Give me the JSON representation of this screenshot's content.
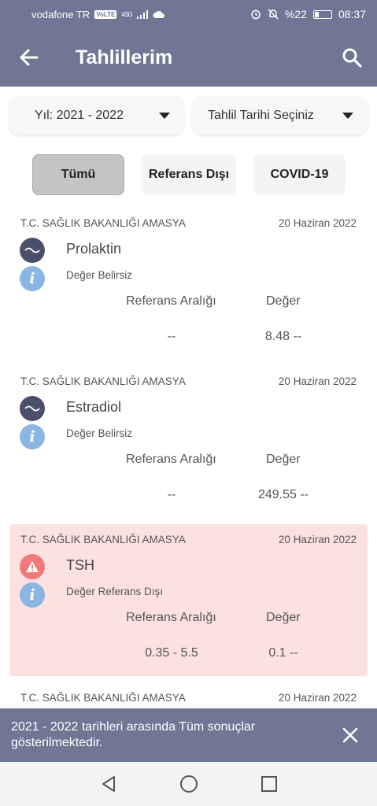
{
  "status_bar": {
    "carrier": "vodafone TR",
    "volte": "VoLTE",
    "network": "4.5G",
    "battery": "%22",
    "time": "08:37"
  },
  "app_bar": {
    "title": "Tahlillerim",
    "back_icon": "arrow-left-icon",
    "search_icon": "search-icon"
  },
  "filters": {
    "year": "Yıl: 2021 - 2022",
    "date": "Tahlil Tarihi Seçiniz"
  },
  "tabs": [
    {
      "label": "Tümü",
      "active": true
    },
    {
      "label": "Referans Dışı",
      "active": false
    },
    {
      "label": "COVID-19",
      "active": false
    }
  ],
  "column_headers": {
    "reference": "Referans Aralığı",
    "value": "Değer"
  },
  "results": [
    {
      "institution": "T.C. SAĞLIK BAKANLIĞI AMASYA",
      "date": "20 Haziran 2022",
      "name": "Prolaktin",
      "status": "Değer Belirsiz",
      "reference": "--",
      "value": "8.48 --",
      "abnormal": false
    },
    {
      "institution": "T.C. SAĞLIK BAKANLIĞI AMASYA",
      "date": "20 Haziran 2022",
      "name": "Estradiol",
      "status": "Değer Belirsiz",
      "reference": "--",
      "value": "249.55 --",
      "abnormal": false
    },
    {
      "institution": "T.C. SAĞLIK BAKANLIĞI AMASYA",
      "date": "20 Haziran 2022",
      "name": "TSH",
      "status": "Değer Referans Dışı",
      "reference": "0.35 - 5.5",
      "value": "0.1 --",
      "abnormal": true
    },
    {
      "institution": "T.C. SAĞLIK BAKANLIĞI AMASYA",
      "date": "20 Haziran 2022"
    }
  ],
  "toast": {
    "message": "2021 - 2022 tarihleri arasında Tüm sonuçlar gösterilmektedir."
  },
  "colors": {
    "primary": "#6f7794",
    "abnormal_bg": "#fde0e0",
    "warning": "#f07a7a",
    "info": "#8cb6e2"
  }
}
